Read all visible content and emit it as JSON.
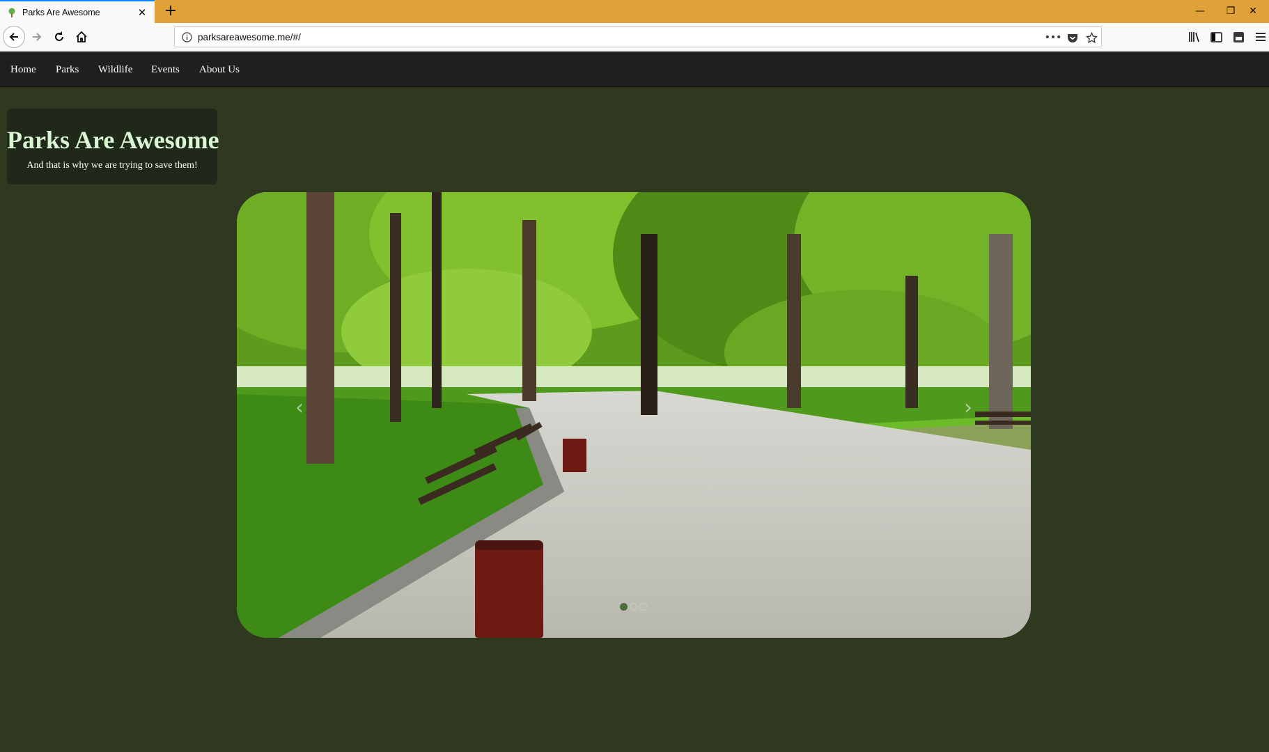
{
  "browser": {
    "tab_title": "Parks Are Awesome",
    "tab_close": "✕",
    "new_tab": "+",
    "url": "parksareawesome.me/#/",
    "page_actions": "•••",
    "window_minimize": "—",
    "window_restore": "❐",
    "window_close": "✕",
    "toolbar_icons": [
      "back-icon",
      "forward-icon",
      "reload-icon",
      "home-icon",
      "info-icon",
      "pocket-icon",
      "star-icon",
      "library-icon",
      "sidebar-icon",
      "screenshot-icon",
      "menu-icon"
    ]
  },
  "site_nav": {
    "items": [
      "Home",
      "Parks",
      "Wildlife",
      "Events",
      "About Us"
    ]
  },
  "hero": {
    "title": "Parks Are Awesome",
    "subtitle": "And that is why we are trying to save them!"
  },
  "carousel": {
    "prev": "‹",
    "next": "›",
    "slide_count": 3,
    "active_index": 0
  },
  "colors": {
    "tabbar": "#e0a138",
    "page_bg": "#2e3920",
    "nav_bg": "#1f1f1f",
    "title_color": "#d9f5d3"
  }
}
